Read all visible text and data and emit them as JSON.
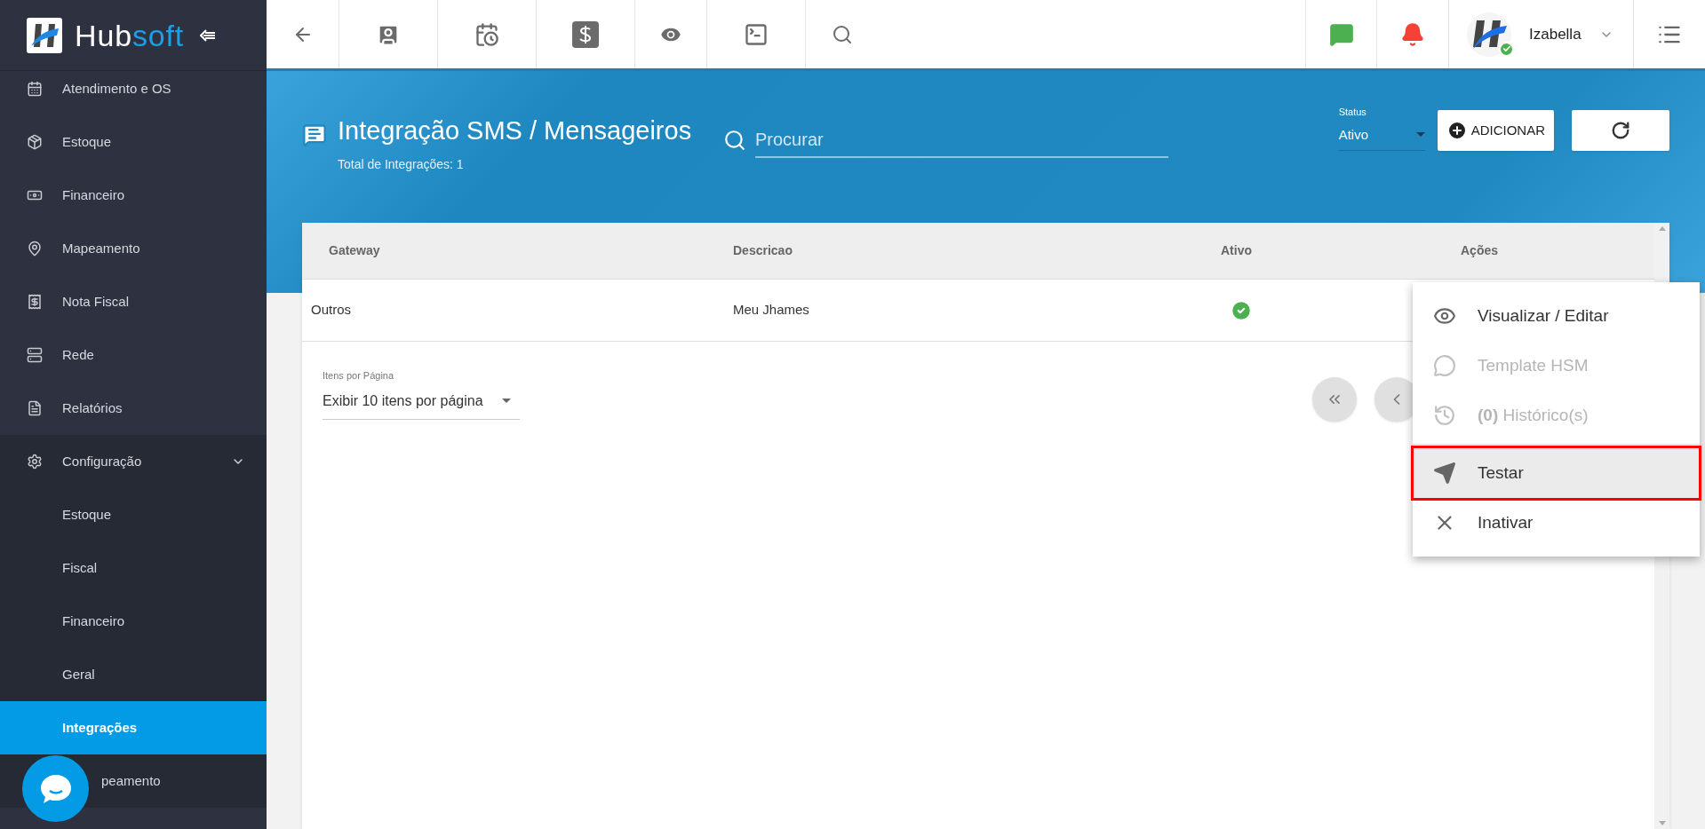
{
  "logo": {
    "first": "Hub",
    "second": "soft"
  },
  "sidebar": {
    "items": [
      {
        "kind": "item",
        "label": "Atendimento e OS",
        "selected": false
      },
      {
        "kind": "item",
        "label": "Estoque",
        "selected": false
      },
      {
        "kind": "item",
        "label": "Financeiro",
        "selected": false
      },
      {
        "kind": "item",
        "label": "Mapeamento",
        "selected": false
      },
      {
        "kind": "item",
        "label": "Nota Fiscal",
        "selected": false
      },
      {
        "kind": "item",
        "label": "Rede",
        "selected": false
      },
      {
        "kind": "item",
        "label": "Relatórios",
        "selected": false
      },
      {
        "kind": "group",
        "label": "Configuração",
        "expanded": true,
        "selected": false
      },
      {
        "kind": "subitem",
        "label": "Estoque",
        "selected": false
      },
      {
        "kind": "subitem",
        "label": "Fiscal",
        "selected": false
      },
      {
        "kind": "subitem",
        "label": "Financeiro",
        "selected": false
      },
      {
        "kind": "subitem",
        "label": "Geral",
        "selected": false
      },
      {
        "kind": "subitem",
        "label": "Integrações",
        "selected": true
      },
      {
        "kind": "subitem",
        "label": "peamento",
        "selected": false
      }
    ]
  },
  "user": {
    "name": "Izabella",
    "online": true
  },
  "page": {
    "title": "Integração SMS / Mensageiros",
    "subtitle": "Total de Integrações: 1",
    "search": {
      "placeholder": "Procurar"
    },
    "status": {
      "label": "Status",
      "value": "Ativo"
    },
    "add_button": "ADICIONAR"
  },
  "table": {
    "columns": [
      "Gateway",
      "Descricao",
      "Ativo",
      "Ações"
    ],
    "rows": [
      {
        "gateway": "Outros",
        "descricao": "Meu Jhames",
        "ativo": true
      }
    ]
  },
  "pagination": {
    "label": "Itens por Página",
    "value": "Exibir 10 itens por página"
  },
  "actions_menu": [
    {
      "kind": "view",
      "label": "Visualizar / Editar",
      "disabled": false,
      "selected": false
    },
    {
      "kind": "whatsapp",
      "label": "Template HSM",
      "disabled": true,
      "selected": false
    },
    {
      "kind": "history",
      "label": "**(0)** Histórico(s)",
      "disabled": true,
      "selected": false
    },
    {
      "kind": "send",
      "label": "Testar",
      "disabled": false,
      "selected": true
    },
    {
      "kind": "close",
      "label": "Inativar",
      "disabled": false,
      "selected": false
    }
  ]
}
